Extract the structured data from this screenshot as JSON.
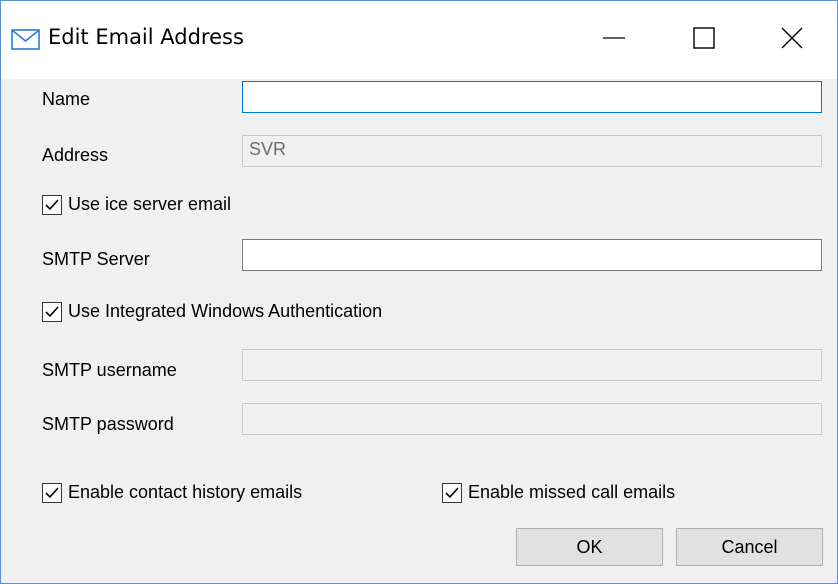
{
  "window": {
    "title": "Edit Email Address",
    "title_icon": "mail-icon",
    "controls": [
      "minimize-icon",
      "maximize-icon",
      "close-icon"
    ]
  },
  "form": {
    "name": {
      "label": "Name",
      "value": ""
    },
    "address": {
      "label": "Address",
      "value": "SVR"
    },
    "use_ice_server_email": {
      "label": "Use ice server email",
      "checked": true
    },
    "smtp_server": {
      "label": "SMTP Server",
      "value": ""
    },
    "use_integrated_windows_auth": {
      "label": "Use Integrated Windows Authentication",
      "checked": true
    },
    "smtp_username": {
      "label": "SMTP username",
      "value": ""
    },
    "smtp_password": {
      "label": "SMTP password",
      "value": ""
    },
    "enable_contact_history_emails": {
      "label": "Enable contact history emails",
      "checked": true
    },
    "enable_missed_call_emails": {
      "label": "Enable missed call emails",
      "checked": true
    }
  },
  "buttons": {
    "ok": "OK",
    "cancel": "Cancel"
  },
  "colors": {
    "accent": "#0078d7",
    "window_border": "#5b8fd0",
    "dialog_bg": "#f0f0f0"
  }
}
